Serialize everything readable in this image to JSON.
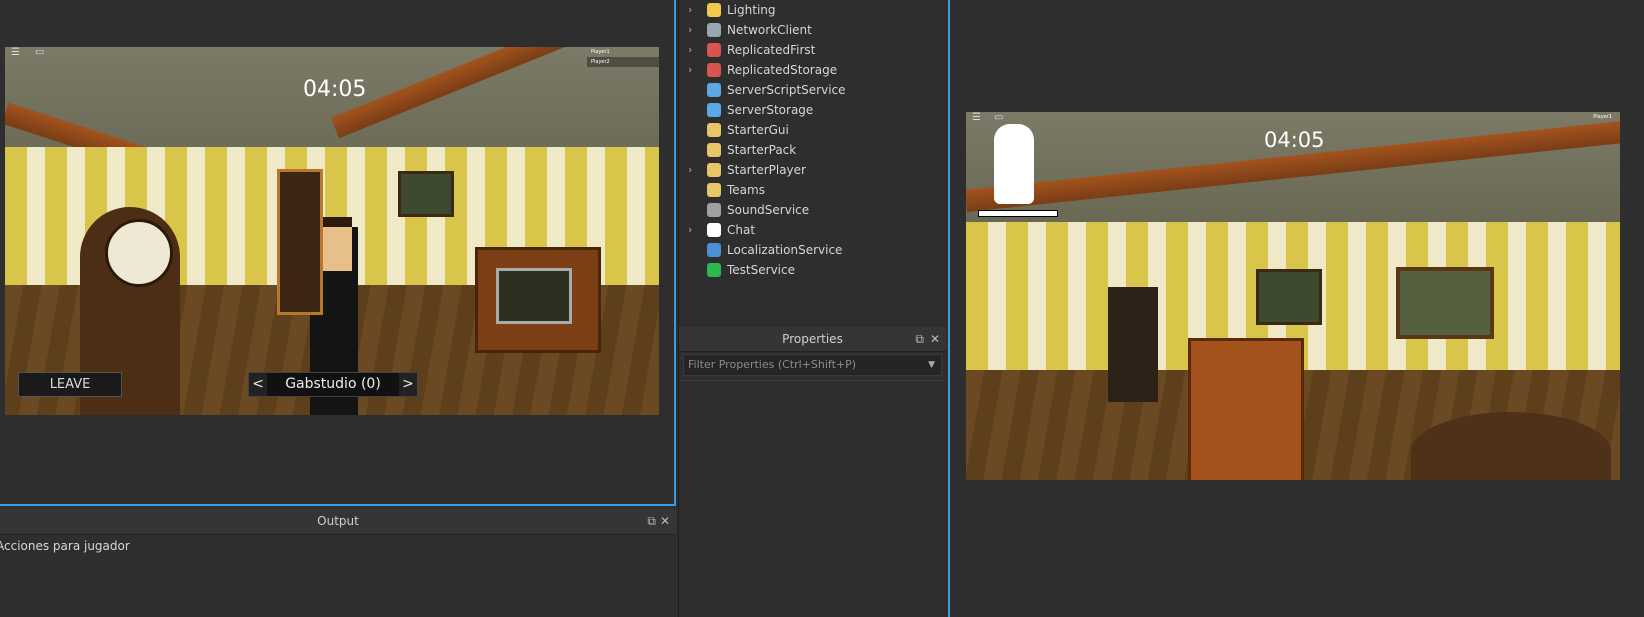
{
  "left_view": {
    "timer": "04:05",
    "leave_label": "LEAVE",
    "spectate": {
      "prev": "<",
      "name": "Gabstudio (0)",
      "next": ">"
    },
    "player_list": [
      "Player1",
      "Player2"
    ]
  },
  "output": {
    "title": "Output",
    "lines": [
      "Acciones para jugador"
    ]
  },
  "explorer": {
    "items": [
      {
        "label": "Lighting",
        "expandable": true,
        "icon": "lightbulb-icon",
        "color": "#f2c94c"
      },
      {
        "label": "NetworkClient",
        "expandable": true,
        "icon": "network-icon",
        "color": "#9aa6b2"
      },
      {
        "label": "ReplicatedFirst",
        "expandable": true,
        "icon": "replicated-first-icon",
        "color": "#d9534f"
      },
      {
        "label": "ReplicatedStorage",
        "expandable": true,
        "icon": "replicated-storage-icon",
        "color": "#d9534f"
      },
      {
        "label": "ServerScriptService",
        "expandable": false,
        "icon": "server-script-icon",
        "color": "#5aa9e6"
      },
      {
        "label": "ServerStorage",
        "expandable": false,
        "icon": "server-storage-icon",
        "color": "#5aa9e6"
      },
      {
        "label": "StarterGui",
        "expandable": false,
        "icon": "folder-icon",
        "color": "#e8c56a"
      },
      {
        "label": "StarterPack",
        "expandable": false,
        "icon": "folder-icon",
        "color": "#e8c56a"
      },
      {
        "label": "StarterPlayer",
        "expandable": true,
        "icon": "folder-icon",
        "color": "#e8c56a"
      },
      {
        "label": "Teams",
        "expandable": false,
        "icon": "folder-icon",
        "color": "#e8c56a"
      },
      {
        "label": "SoundService",
        "expandable": false,
        "icon": "speaker-icon",
        "color": "#a0a0a0"
      },
      {
        "label": "Chat",
        "expandable": true,
        "icon": "chat-icon",
        "color": "#ffffff"
      },
      {
        "label": "LocalizationService",
        "expandable": false,
        "icon": "localization-icon",
        "color": "#4f8fd6"
      },
      {
        "label": "TestService",
        "expandable": false,
        "icon": "check-icon",
        "color": "#2db84d"
      }
    ]
  },
  "properties": {
    "title": "Properties",
    "filter_placeholder": "Filter Properties (Ctrl+Shift+P)"
  },
  "right_view": {
    "timer": "04:05",
    "player_list": [
      "Player1"
    ]
  }
}
